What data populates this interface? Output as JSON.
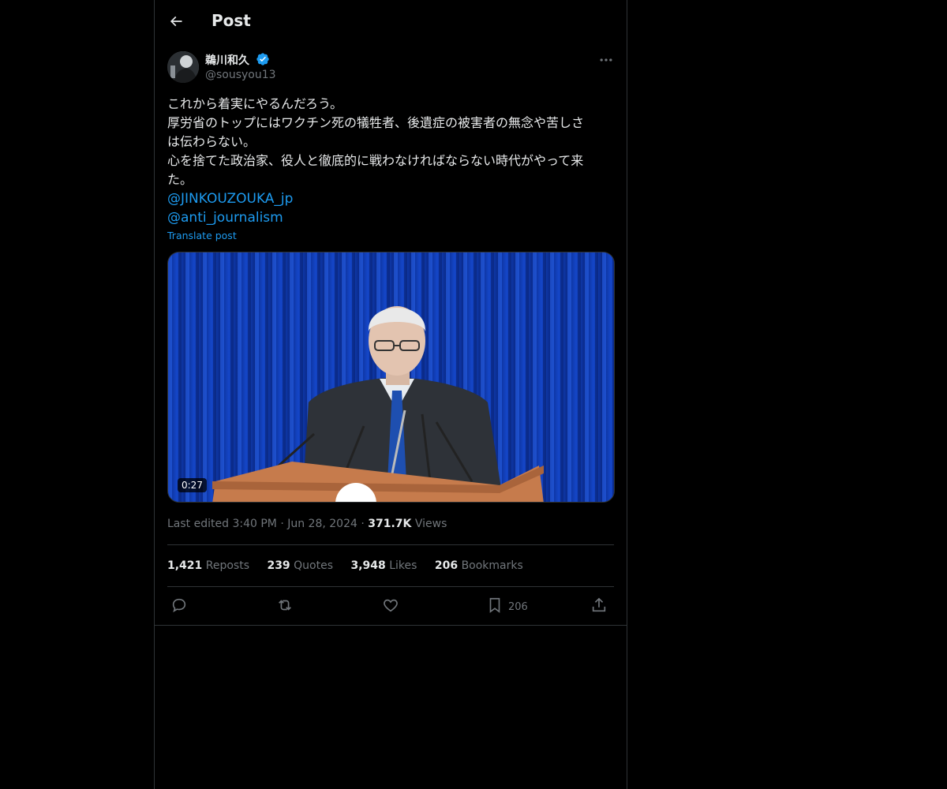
{
  "header": {
    "title": "Post"
  },
  "author": {
    "name": "鵜川和久",
    "handle": "@sousyou13"
  },
  "post": {
    "lines": [
      "これから着実にやるんだろう。",
      "厚労省のトップにはワクチン死の犠牲者、後遺症の被害者の無念や苦しさ",
      "は伝わらない。",
      "心を捨てた政治家、役人と徹底的に戦わなければならない時代がやって来",
      "た。"
    ],
    "mentions": [
      "@JINKOUZOUKA_jp",
      "@anti_journalism"
    ],
    "translate_label": "Translate post"
  },
  "media": {
    "duration": "0:27"
  },
  "meta": {
    "edited": "Last edited 3:40 PM",
    "sep1": "·",
    "date": "Jun 28, 2024",
    "sep2": "·",
    "views_count": "371.7K",
    "views_label": "Views"
  },
  "stats": [
    {
      "count": "1,421",
      "label": "Reposts"
    },
    {
      "count": "239",
      "label": "Quotes"
    },
    {
      "count": "3,948",
      "label": "Likes"
    },
    {
      "count": "206",
      "label": "Bookmarks"
    }
  ],
  "actions": {
    "bookmark_count": "206"
  },
  "icons": [
    "back-arrow-icon",
    "verified-icon",
    "more-icon",
    "reply-icon",
    "repost-icon",
    "like-icon",
    "bookmark-icon",
    "share-icon"
  ],
  "colors": {
    "accent": "#1d9bf0",
    "background": "#000000",
    "muted": "#71767b",
    "text": "#e7e9ea"
  }
}
